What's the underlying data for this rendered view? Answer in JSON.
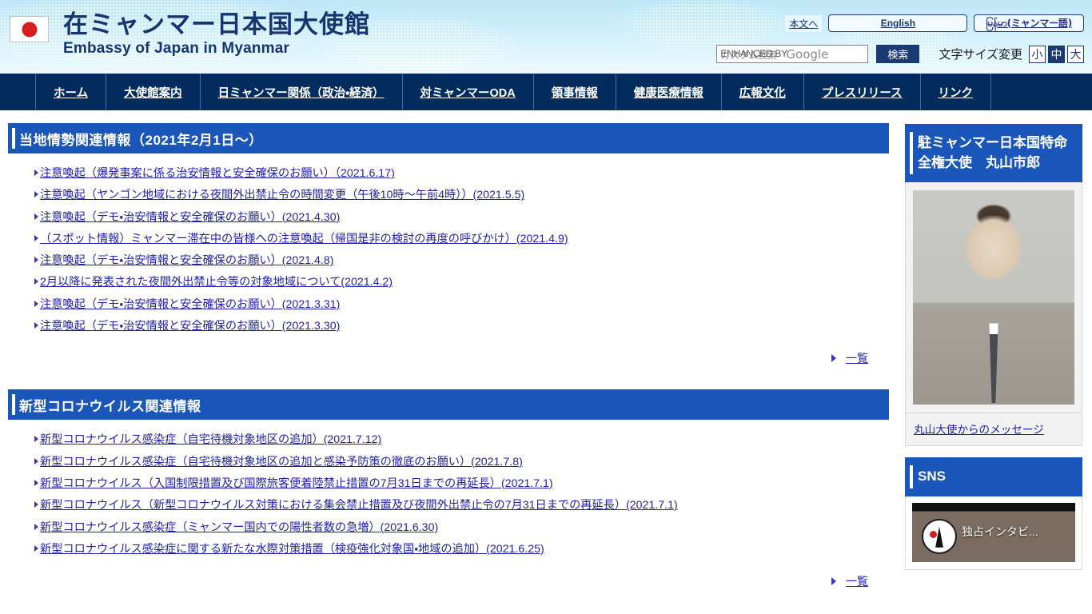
{
  "header": {
    "flag_alt": "japan-flag",
    "title_ja": "在ミャンマー日本国大使館",
    "title_en": "Embassy of Japan in Myanmar",
    "skip_link": "本文へ",
    "lang_english": "English",
    "lang_myanmar": "မြန်မာ(ミャンマー語)",
    "lang_myanmar_fallback": "မြန်မာ",
    "search": {
      "placeholder_overlay_a": "ENHANCED BY",
      "placeholder_overlay_b": "カスタム検索",
      "google_label": "Google",
      "submit_label": "検索"
    },
    "fontsize": {
      "label": "文字サイズ変更",
      "options": [
        {
          "label": "小",
          "active": false
        },
        {
          "label": "中",
          "active": true
        },
        {
          "label": "大",
          "active": false
        }
      ]
    }
  },
  "nav": {
    "items": [
      {
        "label": "ホーム"
      },
      {
        "label": "大使館案内"
      },
      {
        "label": "日ミャンマー関係（政治・経済）"
      },
      {
        "label": "対ミャンマーODA"
      },
      {
        "label": "領事情報"
      },
      {
        "label": "健康医療情報"
      },
      {
        "label": "広報文化"
      },
      {
        "label": "プレスリリース"
      },
      {
        "label": "リンク"
      }
    ]
  },
  "sections": [
    {
      "title": "当地情勢関連情報（2021年2月1日〜）",
      "more_label": "一覧",
      "links": [
        "注意喚起（爆発事案に係る治安情報と安全確保のお願い）（2021.6.17)",
        "注意喚起（ヤンゴン地域における夜間外出禁止令の時間変更（午後10時〜午前4時））(2021.5.5)",
        "注意喚起（デモ・治安情報と安全確保のお願い）(2021.4.30)",
        "（スポット情報）ミャンマー滞在中の皆様への注意喚起（帰国是非の検討の再度の呼びかけ）(2021.4.9)",
        "注意喚起（デモ・治安情報と安全確保のお願い）(2021.4.8)",
        "2月以降に発表された夜間外出禁止令等の対象地域について(2021.4.2)",
        "注意喚起（デモ・治安情報と安全確保のお願い）(2021.3.31)",
        "注意喚起（デモ・治安情報と安全確保のお願い）(2021.3.30)"
      ]
    },
    {
      "title": "新型コロナウイルス関連情報",
      "more_label": "一覧",
      "links": [
        "新型コロナウイルス感染症（自宅待機対象地区の追加）(2021.7.12)",
        "新型コロナウイルス感染症（自宅待機対象地区の追加と感染予防策の徹底のお願い）(2021.7.8)",
        "新型コロナウイルス（入国制限措置及び国際旅客便着陸禁止措置の7月31日までの再延長）(2021.7.1)",
        "新型コロナウイルス（新型コロナウイルス対策における集会禁止措置及び夜間外出禁止令の7月31日までの再延長）(2021.7.1)",
        "新型コロナウイルス感染症（ミャンマー国内での陽性者数の急増）(2021.6.30)",
        "新型コロナウイルス感染症に関する新たな水際対策措置（検疫強化対象国・地域の追加）(2021.6.25)"
      ]
    }
  ],
  "sidebar": {
    "ambassador": {
      "heading": "駐ミャンマー日本国特命全権大使　丸山市郎",
      "photo_alt": "ambassador-portrait",
      "message_link": "丸山大使からのメッセージ"
    },
    "sns": {
      "heading": "SNS",
      "video_caption": "独占インタビ..."
    }
  },
  "colors": {
    "nav_bg": "#032c5e",
    "section_heading": "#1b56ba",
    "link": "#2222aa",
    "header_gradient_top": "#bfe6f7",
    "search_button": "#1b3a72"
  }
}
